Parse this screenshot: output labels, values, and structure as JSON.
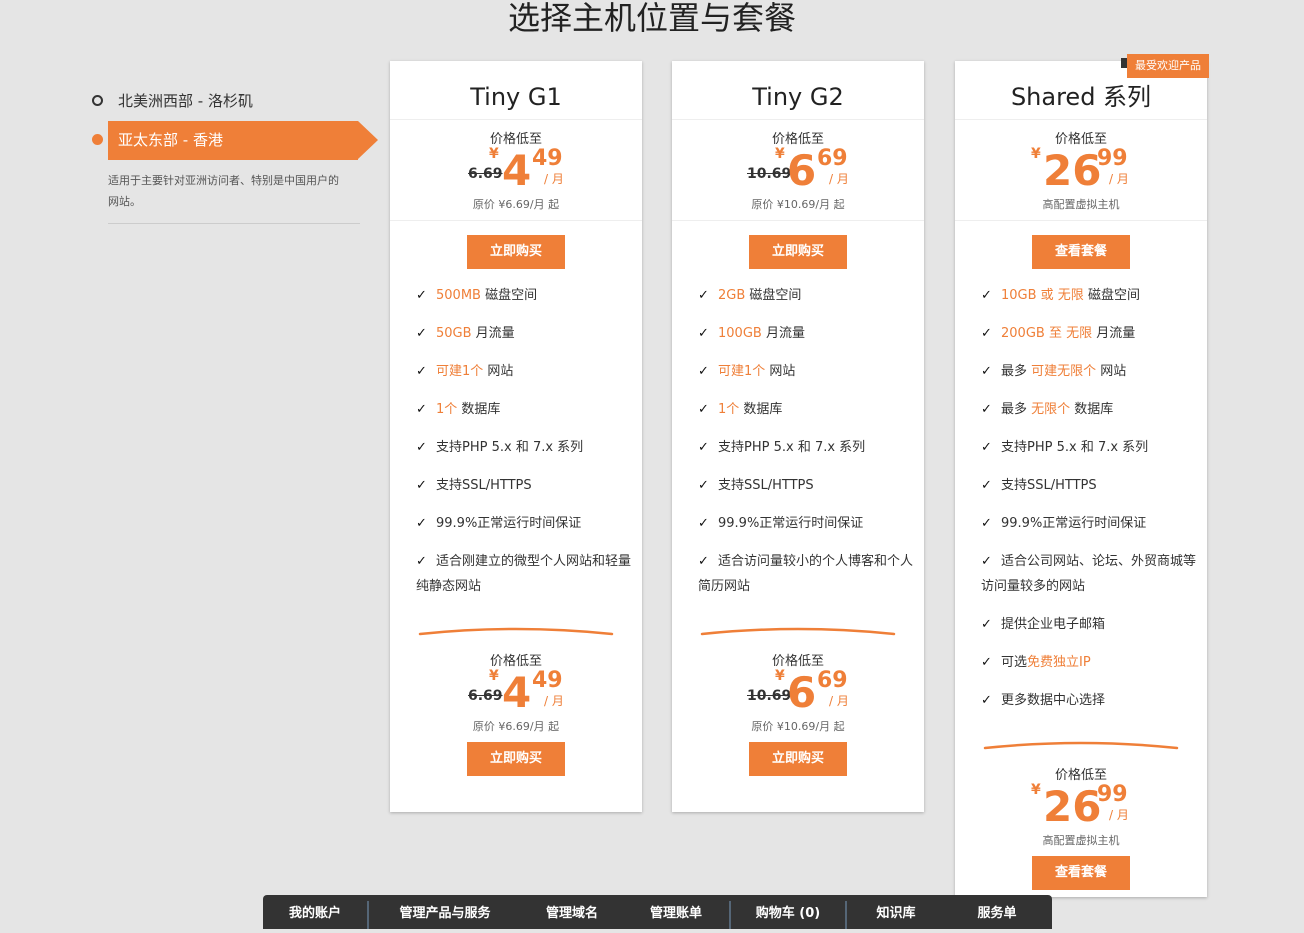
{
  "page_title": "选择主机位置与套餐",
  "locations": {
    "items": [
      {
        "label": "北美洲西部 - 洛杉矶",
        "active": false
      },
      {
        "label": "亚太东部 - 香港",
        "active": true
      }
    ],
    "active_description": "适用于主要针对亚洲访问者、特别是中国用户的网站。"
  },
  "plans": [
    {
      "name": "Tiny G1",
      "price_caption": "价格低至",
      "old_price": "6.69",
      "currency": "¥",
      "price_int": "4",
      "price_dec": "49",
      "per": "/ 月",
      "price_sub": "原价 ¥6.69/月 起",
      "button_label": "立即购买",
      "features": [
        [
          {
            "t": "500MB",
            "h": true
          },
          {
            "t": " 磁盘空间",
            "h": false
          }
        ],
        [
          {
            "t": "50GB",
            "h": true
          },
          {
            "t": " 月流量",
            "h": false
          }
        ],
        [
          {
            "t": "可建1个",
            "h": true
          },
          {
            "t": " 网站",
            "h": false
          }
        ],
        [
          {
            "t": "1个",
            "h": true
          },
          {
            "t": " 数据库",
            "h": false
          }
        ],
        [
          {
            "t": "支持PHP 5.x 和 7.x 系列",
            "h": false
          }
        ],
        [
          {
            "t": "支持SSL/HTTPS",
            "h": false
          }
        ],
        [
          {
            "t": "99.9%正常运行时间保证",
            "h": false
          }
        ],
        [
          {
            "t": "适合刚建立的微型个人网站和轻量纯静态网站",
            "h": false
          }
        ]
      ]
    },
    {
      "name": "Tiny G2",
      "price_caption": "价格低至",
      "old_price": "10.69",
      "currency": "¥",
      "price_int": "6",
      "price_dec": "69",
      "per": "/ 月",
      "price_sub": "原价 ¥10.69/月 起",
      "button_label": "立即购买",
      "features": [
        [
          {
            "t": "2GB",
            "h": true
          },
          {
            "t": " 磁盘空间",
            "h": false
          }
        ],
        [
          {
            "t": "100GB",
            "h": true
          },
          {
            "t": " 月流量",
            "h": false
          }
        ],
        [
          {
            "t": "可建1个",
            "h": true
          },
          {
            "t": " 网站",
            "h": false
          }
        ],
        [
          {
            "t": "1个",
            "h": true
          },
          {
            "t": " 数据库",
            "h": false
          }
        ],
        [
          {
            "t": "支持PHP 5.x 和 7.x 系列",
            "h": false
          }
        ],
        [
          {
            "t": "支持SSL/HTTPS",
            "h": false
          }
        ],
        [
          {
            "t": "99.9%正常运行时间保证",
            "h": false
          }
        ],
        [
          {
            "t": "适合访问量较小的个人博客和个人简历网站",
            "h": false
          }
        ]
      ]
    },
    {
      "name": "Shared 系列",
      "badge": "最受欢迎产品",
      "price_caption": "价格低至",
      "old_price": "",
      "currency": "¥",
      "price_int": "26",
      "price_dec": "99",
      "per": "/ 月",
      "price_sub": "高配置虚拟主机",
      "button_label": "查看套餐",
      "features": [
        [
          {
            "t": "10GB 或 无限",
            "h": true
          },
          {
            "t": " 磁盘空间",
            "h": false
          }
        ],
        [
          {
            "t": "200GB 至 无限",
            "h": true
          },
          {
            "t": " 月流量",
            "h": false
          }
        ],
        [
          {
            "t": "最多 ",
            "h": false
          },
          {
            "t": "可建无限个",
            "h": true
          },
          {
            "t": " 网站",
            "h": false
          }
        ],
        [
          {
            "t": "最多 ",
            "h": false
          },
          {
            "t": "无限个",
            "h": true
          },
          {
            "t": " 数据库",
            "h": false
          }
        ],
        [
          {
            "t": "支持PHP 5.x 和 7.x 系列",
            "h": false
          }
        ],
        [
          {
            "t": "支持SSL/HTTPS",
            "h": false
          }
        ],
        [
          {
            "t": "99.9%正常运行时间保证",
            "h": false
          }
        ],
        [
          {
            "t": "适合公司网站、论坛、外贸商城等访问量较多的网站",
            "h": false
          }
        ],
        [
          {
            "t": "提供企业电子邮箱",
            "h": false
          }
        ],
        [
          {
            "t": "可选",
            "h": false
          },
          {
            "t": "免费独立IP",
            "h": true
          }
        ],
        [
          {
            "t": "更多数据中心选择",
            "h": false
          }
        ]
      ]
    }
  ],
  "bottom_nav": [
    "我的账户",
    "管理产品与服务",
    "管理域名",
    "管理账单",
    "购物车 (0)",
    "知识库",
    "服务单"
  ],
  "colors": {
    "accent": "#ef7f38",
    "nav_bg": "#333333"
  }
}
